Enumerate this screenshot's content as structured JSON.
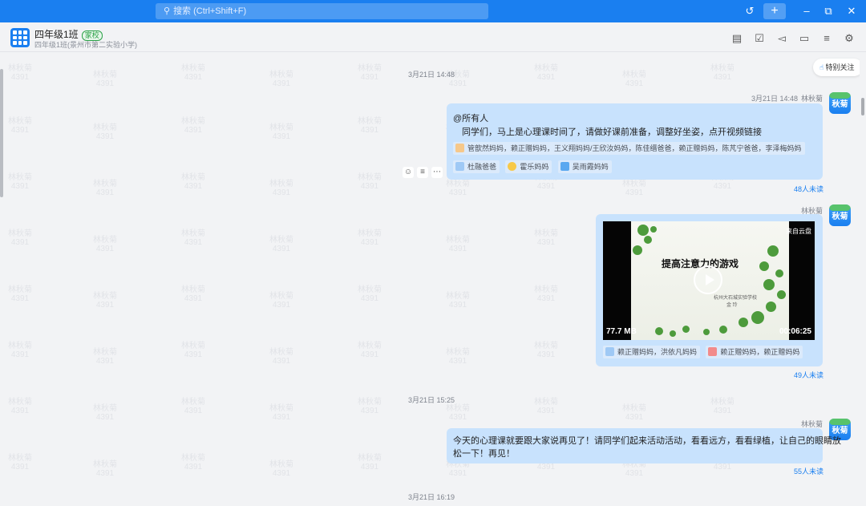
{
  "titlebar": {
    "search_placeholder": "搜索 (Ctrl+Shift+F)",
    "icons": [
      "search-icon",
      "history-icon",
      "add-icon",
      "minimize-icon",
      "restore-icon",
      "close-icon"
    ],
    "accent_color": "#1a7ff0"
  },
  "header": {
    "group_name": "四年级1班",
    "badge": "家校",
    "group_subtitle": "四年级1班(景州市第二实验小学)",
    "icons": [
      "notice-icon",
      "checkin-icon",
      "announcement-icon",
      "folder-icon",
      "search-history-icon",
      "settings-icon"
    ]
  },
  "follow_button": "特别关注",
  "watermark": {
    "name": "林秋菊",
    "number": "4391"
  },
  "messages": [
    {
      "time": "3月21日 14:48",
      "sender": "林秋菊",
      "sender_time": "3月21日 14:48",
      "avatar_text": "秋菊",
      "mention": "@所有人",
      "text": "同学们，马上是心理课时间了，请做好课前准备，调整好坐姿，点开视频链接",
      "reactions": [
        {
          "icon": "clap-icon",
          "label": "管歆然妈妈，赖正赠妈妈，王义翔妈妈/王欣汝妈妈，陈佳缙爸爸，赖正赠妈妈，陈芃宁爸爸，李泽梅妈妈"
        },
        {
          "icon": "thumbs-up-icon",
          "label": "杜融爸爸"
        },
        {
          "icon": "cool-emoji-icon",
          "label": "霍乐妈妈"
        },
        {
          "icon": "ok-icon",
          "label": "吴雨霞妈妈"
        }
      ],
      "unread": "48人未读"
    },
    {
      "sender": "林秋菊",
      "avatar_text": "秋菊",
      "video": {
        "title": "提高注意力的游戏",
        "school": "杭州大石城实验学校",
        "author": "金 玲",
        "size": "77.7 MB",
        "duration": "00:06:25",
        "source": "来自云盘"
      },
      "reactions": [
        {
          "icon": "thumbs-up-icon",
          "label": "赖正赠妈妈，洪依凡妈妈"
        },
        {
          "icon": "flower-icon",
          "label": "赖正赠妈妈，赖正赠妈妈"
        }
      ],
      "unread": "49人未读"
    },
    {
      "time": "3月21日 15:25",
      "sender": "林秋菊",
      "avatar_text": "秋菊",
      "text_line1": "今天的心理课就要跟大家说再见了！请同学们起来活动活动，看看远方，看看绿植，让自己的眼睛放",
      "text_line2": "松一下！再见！",
      "unread": "55人未读"
    },
    {
      "time": "3月21日 16:19"
    }
  ],
  "bubble_color": "#c8e2fd"
}
